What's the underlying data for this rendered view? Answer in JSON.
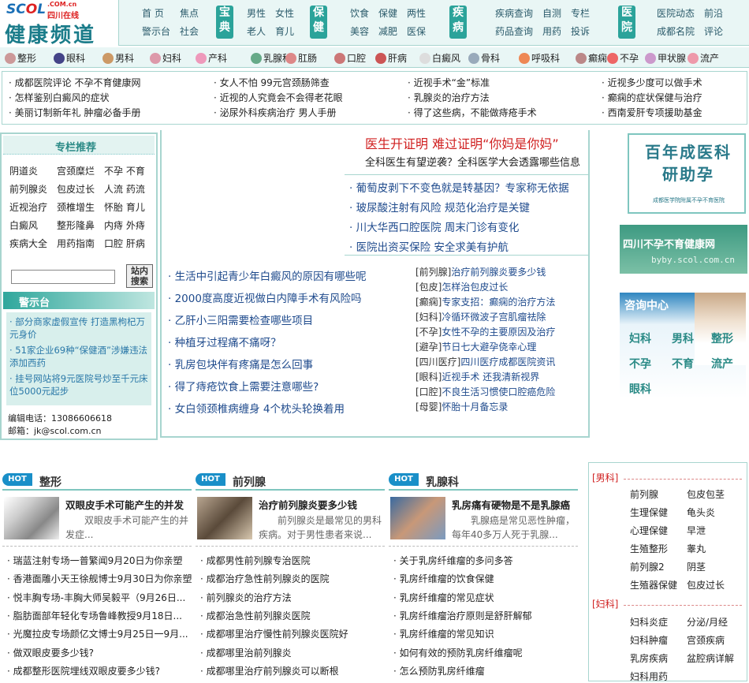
{
  "logo": {
    "brand": "SCOL",
    "domain": ".COM.cn",
    "cn": "四川在线",
    "title": "健康频道"
  },
  "nav": {
    "g1": [
      "首 页",
      "焦点",
      "警示台",
      "社会"
    ],
    "b1": "宝典",
    "g2": [
      "男性",
      "女性",
      "老人",
      "育儿"
    ],
    "b2": "保健",
    "g3": [
      "饮食",
      "保健",
      "两性",
      "美容",
      "减肥",
      "医保"
    ],
    "b3": "疾病",
    "g4": [
      "疾病查询",
      "自测",
      "专栏",
      "药品查询",
      "用药",
      "投诉"
    ],
    "b4": "医院",
    "g5": [
      "医院动态",
      "前沿",
      "成都名院",
      "评论"
    ]
  },
  "categories": [
    "整形",
    "眼科",
    "男科",
    "妇科",
    "产科",
    "乳腺科",
    "肛肠",
    "口腔",
    "肝病",
    "白癜风",
    "骨科",
    "呼吸科",
    "癫痫",
    "不孕",
    "甲状腺",
    "流产"
  ],
  "headlines": [
    [
      "成都医院评论 不孕不育健康网",
      "怎样鉴别白癜风的症状",
      "美丽订制新年礼 肿瘤必备手册"
    ],
    [
      "女人不怕 99元宫颈肠筛查",
      "近视的人究竟会不会得老花眼",
      "泌尿外科疾病治疗 男人手册"
    ],
    [
      "近视手术“金”标准",
      "乳腺炎的治疗方法",
      "得了这些病，不能做痔疮手术"
    ],
    [
      "近视多少度可以做手术",
      "癫痫的症状保健与治疗",
      "西南爱肝专项援助基金"
    ]
  ],
  "column": {
    "title": "专栏推荐",
    "items": [
      [
        "阴道炎",
        "宫颈糜烂",
        "不孕 不育"
      ],
      [
        "前列腺炎",
        "包皮过长",
        "人流 药流"
      ],
      [
        "近视治疗",
        "颈椎增生",
        "怀胎 育儿"
      ],
      [
        "白癜风",
        "整形隆鼻",
        "内痔 外痔"
      ],
      [
        "疾病大全",
        "用药指南",
        "口腔 肝病"
      ]
    ]
  },
  "search": {
    "placeholder": "",
    "button": "站内搜索"
  },
  "warning": {
    "title": "警示台",
    "items": [
      "· 部分商家虚假宣传 打造黑枸杞万元身价",
      "· 51家企业69种“保健酒”涉嫌违法添加西药",
      "· 挂号网站将9元医院号炒至千元床位5000元起步"
    ]
  },
  "contact": {
    "tel": "编辑电话：13086606618",
    "mail": "邮箱：jk@scol.com.cn"
  },
  "focus": {
    "headline": "医生开证明  难过证明“你妈是你妈”",
    "sub": "全科医生有望逆袭？全科医学大会透露哪些信息",
    "news": [
      "葡萄皮剥下不变色就是转基因？专家称无依据",
      "玻尿酸注射有风险  规范化治疗是关键",
      "川大华西口腔医院  周末门诊有变化",
      "医院出资买保险  安全求美有护航"
    ]
  },
  "leftlist": [
    "生活中引起青少年白癜风的原因有哪些呢",
    "2000度高度近视做白内障手术有风险吗",
    "乙肝小三阳需要检查哪些项目",
    "种植牙过程痛不痛呀？",
    "乳房包块伴有疼痛是怎么回事",
    "得了痔疮饮食上需要注意哪些?",
    "女白领颈椎病缠身  4个枕头轮换着用"
  ],
  "taglist": [
    [
      "[前列腺]",
      "治疗前列腺炎要多少钱"
    ],
    [
      "[包皮]",
      "怎样治包皮过长"
    ],
    [
      "[癫痫]",
      "专家支招：癫痫的治疗方法"
    ],
    [
      "[妇科]",
      "冷循环微波子宫肌瘤祛除"
    ],
    [
      "[不孕]",
      "女性不孕的主要原因及治疗"
    ],
    [
      "[避孕]",
      "节日七大避孕侥幸心理"
    ],
    [
      "[四川医疗]",
      "四川医疗成都医院资讯"
    ],
    [
      "[眼科]",
      "近视手术  还我清新视界"
    ],
    [
      "[口腔]",
      "不良生活习惯使口腔癌危险"
    ],
    [
      "[母婴]",
      "怀胎十月备忘录"
    ]
  ],
  "ads": {
    "a1": "百年成医科研助孕",
    "a1sub": "成都医学院附属不孕不育医院",
    "a2": "四川不孕不育健康网",
    "a2url": "byby.scol.com.cn",
    "a3title": "咨询中心",
    "a3items": [
      "妇科",
      "男科",
      "整形",
      "不孕",
      "不育",
      "流产",
      "眼科"
    ]
  },
  "sections": [
    {
      "hot": "HOT",
      "title": "整形",
      "ltitle": "双眼皮手术可能产生的并发",
      "desc": "双眼皮手术可能产生的并发症...",
      "items": [
        "瑞蓝注射专场一普繁闻9月20日为你亲塑",
        "香港面雕小天王徐舰博士9月30日为你亲塑",
        "悦丰胸专场-丰胸大师吴毅平（9月26日...",
        "脂肪面部年轻化专场鲁峰教授9月18日...",
        "光魔拉皮专场颜亿文博士9月25日一9月...",
        "做双眼皮要多少钱?",
        "成都整形医院埋线双眼皮要多少钱?"
      ]
    },
    {
      "hot": "HOT",
      "title": "前列腺",
      "ltitle": "治疗前列腺炎要多少钱",
      "desc": "前列腺炎是最常见的男科疾病。对于男性患者来说...",
      "items": [
        "成都男性前列腺专治医院",
        "成都治疗急性前列腺炎的医院",
        "前列腺炎的治疗方法",
        "成都治急性前列腺炎医院",
        "成都哪里治疗慢性前列腺炎医院好",
        "成都哪里治前列腺炎",
        "成都哪里治疗前列腺炎可以断根"
      ]
    },
    {
      "hot": "HOT",
      "title": "乳腺科",
      "ltitle": "乳房痛有硬物是不是乳腺癌",
      "desc": "乳腺癌是常见恶性肿瘤，每年40多万人死于乳腺...",
      "items": [
        "关于乳房纤维瘤的多问多答",
        "乳房纤维瘤的饮食保健",
        "乳房纤维瘤的常见症状",
        "乳房纤维瘤治疗原则是舒肝解郁",
        "乳房纤维瘤的常见知识",
        "如何有效的预防乳房纤维瘤呢",
        "怎么预防乳房纤维瘤"
      ]
    }
  ],
  "rightbox": {
    "men": "[男科]",
    "menitems": [
      [
        "前列腺",
        "包皮包茎"
      ],
      [
        "生理保健",
        "龟头炎"
      ],
      [
        "心理保健",
        "早泄"
      ],
      [
        "生殖整形",
        "睾丸"
      ],
      [
        "前列腺2",
        "阴茎"
      ],
      [
        "生殖器保健",
        "包皮过长"
      ]
    ],
    "women": "[妇科]",
    "womenitems": [
      [
        "妇科炎症",
        "分泌/月经"
      ],
      [
        "妇科肿瘤",
        "宫颈疾病"
      ],
      [
        "乳房疾病",
        "盆腔病详解"
      ],
      [
        "妇科用药",
        ""
      ]
    ]
  }
}
